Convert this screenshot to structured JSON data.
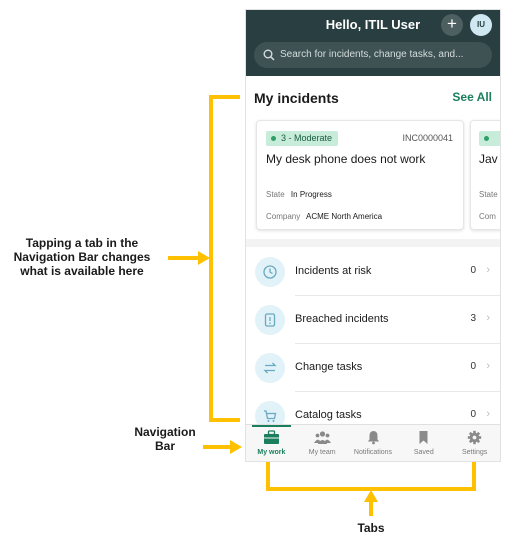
{
  "header": {
    "title": "Hello, ITIL User",
    "plus": "+",
    "avatar_initials": "IU"
  },
  "search": {
    "placeholder": "Search for incidents, change tasks, and..."
  },
  "section": {
    "title": "My incidents",
    "see_all": "See All"
  },
  "card1": {
    "priority": "3 - Moderate",
    "number": "INC0000041",
    "title": "My desk phone does not work",
    "state_label": "State",
    "state_value": "In Progress",
    "company_label": "Company",
    "company_value": "ACME North America"
  },
  "card2": {
    "title": "Jav",
    "state_label": "State",
    "company_label": "Com"
  },
  "list": [
    {
      "label": "Incidents at risk",
      "count": "0",
      "icon": "clock-icon"
    },
    {
      "label": "Breached incidents",
      "count": "3",
      "icon": "alert-icon"
    },
    {
      "label": "Change tasks",
      "count": "0",
      "icon": "swap-arrows-icon"
    },
    {
      "label": "Catalog tasks",
      "count": "0",
      "icon": "cart-icon"
    }
  ],
  "tabs": [
    {
      "label": "My work",
      "icon": "briefcase-icon",
      "active": true
    },
    {
      "label": "My team",
      "icon": "team-icon",
      "active": false
    },
    {
      "label": "Notifications",
      "icon": "bell-icon",
      "active": false
    },
    {
      "label": "Saved",
      "icon": "bookmark-icon",
      "active": false
    },
    {
      "label": "Settings",
      "icon": "gear-icon",
      "active": false
    }
  ],
  "annotations": {
    "tap_line1": "Tapping a tab in the",
    "tap_line2": "Navigation Bar changes",
    "tap_line3": "what is available here",
    "nav_line1": "Navigation",
    "nav_line2": "Bar",
    "tabs": "Tabs"
  },
  "colors": {
    "header": "#293e40",
    "accent": "#1b7f5c",
    "annotation": "#ffc000"
  }
}
